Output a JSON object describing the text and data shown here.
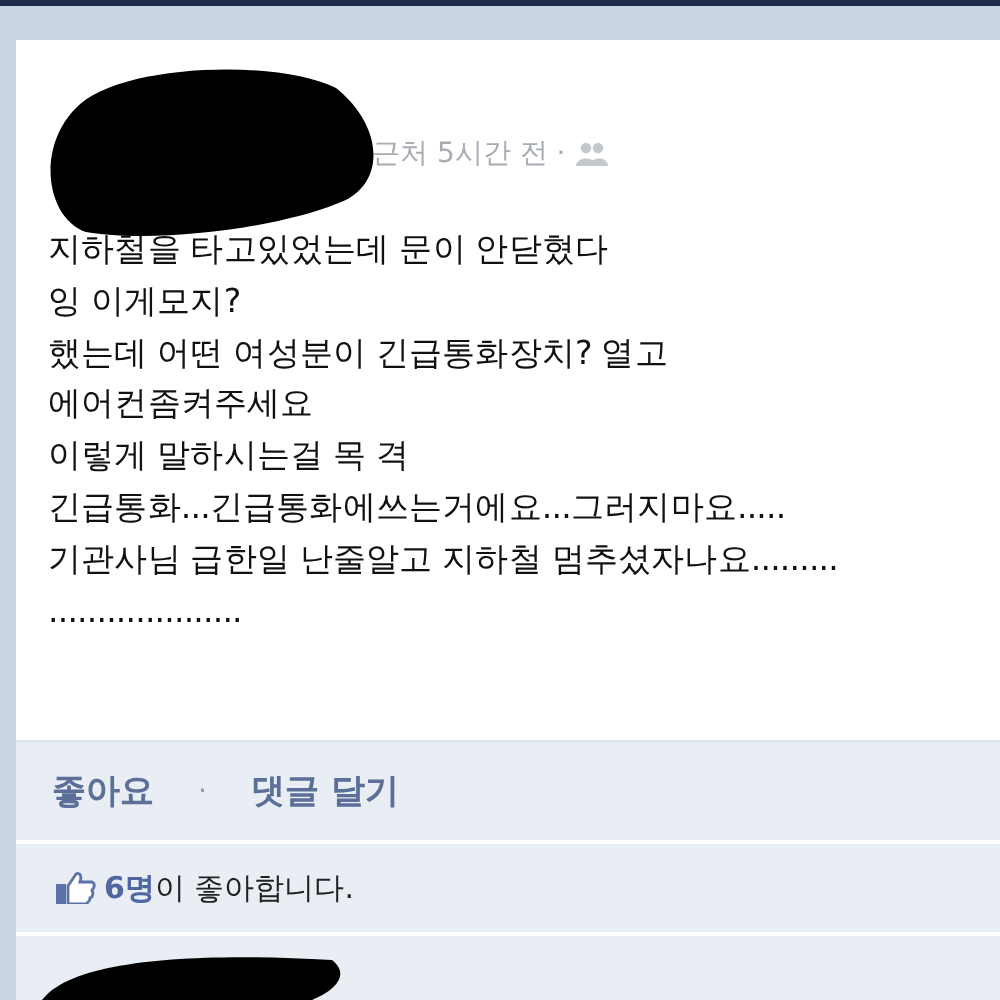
{
  "post": {
    "meta": "근처 5시간 전 ·",
    "lines": [
      "지하철을 타고있었는데 문이 안닫혔다",
      "잉 이게모지?",
      "했는데 어떤 여성분이 긴급통화장치? 열고",
      "에어컨좀켜주세요",
      "이렇게 말하시는걸 목 격",
      "긴급통화...긴급통화에쓰는거에요...그러지마요.....",
      "기관사님 급한일 난줄알고 지하철 멈추셨자나요.........",
      "...................."
    ]
  },
  "actions": [
    "좋아요",
    "·",
    "댓글 달기"
  ],
  "likes": {
    "text": "**6명**이 좋아합니다."
  }
}
